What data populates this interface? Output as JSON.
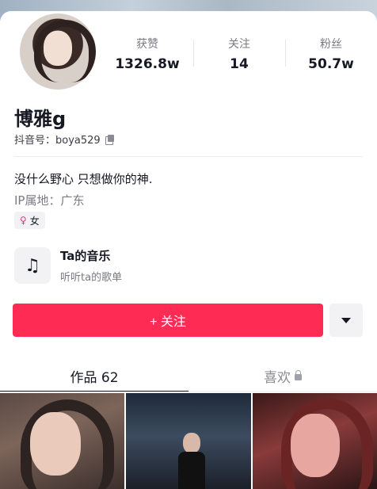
{
  "profile": {
    "name": "博雅g",
    "account": "抖音号：boya529",
    "bio": "没什么野心 只想做你的神.",
    "ip": "IP属地：广东",
    "gender_tag": "女"
  },
  "stats": [
    {
      "label": "获赞",
      "value": "1326.8w"
    },
    {
      "label": "关注",
      "value": "14"
    },
    {
      "label": "粉丝",
      "value": "50.7w"
    }
  ],
  "music": {
    "title": "Ta的音乐",
    "subtitle": "听听ta的歌单",
    "icon": "music-note-icon"
  },
  "actions": {
    "follow_label": "+ 关注"
  },
  "tabs": [
    {
      "label": "作品 62",
      "active": true
    },
    {
      "label": "喜欢",
      "active": false,
      "locked": true
    }
  ],
  "colors": {
    "accent": "#fe2c55",
    "text": "#161823",
    "secondary": "#7a7b82"
  }
}
